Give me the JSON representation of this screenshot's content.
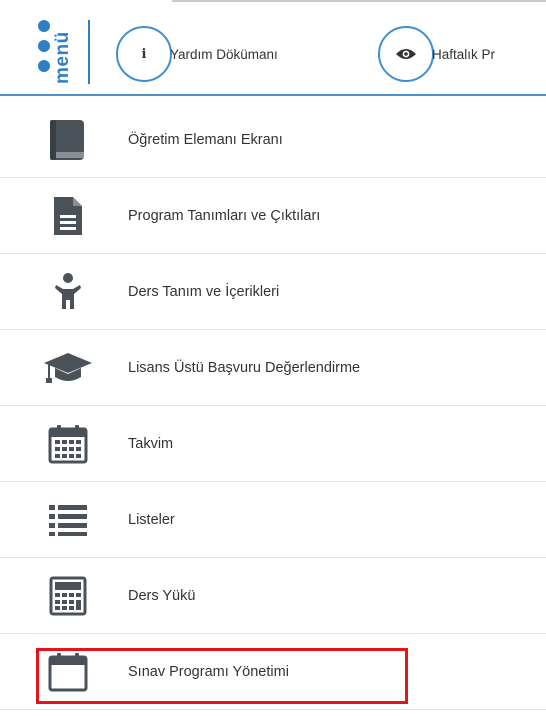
{
  "header": {
    "logo_text": "menü",
    "buttons": [
      {
        "label": "Yardım Dökümanı",
        "icon": "info-icon"
      },
      {
        "label": "Haftalık Pr",
        "icon": "eye-icon"
      }
    ]
  },
  "menu": {
    "items": [
      {
        "label": "Öğretim Elemanı Ekranı",
        "icon": "book-icon"
      },
      {
        "label": "Program Tanımları ve Çıktıları",
        "icon": "document-icon"
      },
      {
        "label": "Ders Tanım ve İçerikleri",
        "icon": "child-icon"
      },
      {
        "label": "Lisans Üstü Başvuru Değerlendirme",
        "icon": "graduation-cap-icon"
      },
      {
        "label": "Takvim",
        "icon": "calendar-icon"
      },
      {
        "label": "Listeler",
        "icon": "list-icon"
      },
      {
        "label": "Ders Yükü",
        "icon": "calculator-icon"
      },
      {
        "label": "Sınav Programı Yönetimi",
        "icon": "calendar-blank-icon",
        "highlighted": true
      }
    ]
  },
  "colors": {
    "accent": "#2e7fc6",
    "icon": "#4b5158",
    "highlight": "#e3151a"
  }
}
